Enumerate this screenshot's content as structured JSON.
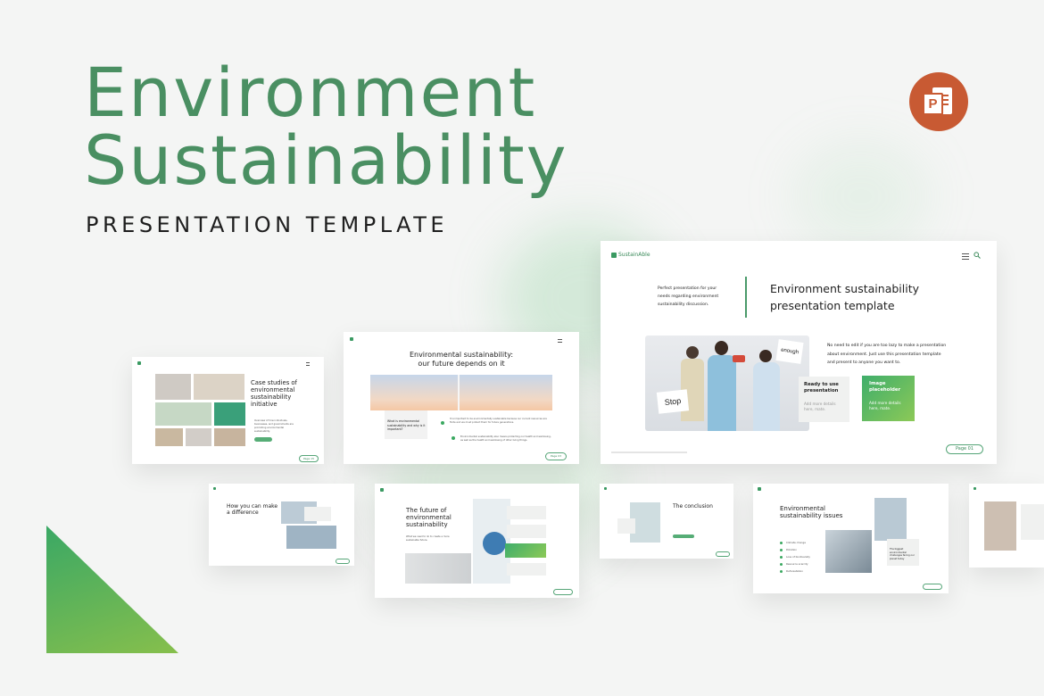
{
  "hero": {
    "title_line1": "Environment",
    "title_line2": "Sustainability",
    "subtitle": "PRESENTATION TEMPLATE",
    "app_icon": "powerpoint-icon",
    "app_badge": "P"
  },
  "colors": {
    "brand_green": "#4a8f62",
    "powerpoint_orange": "#c85a33",
    "background": "#f4f5f4"
  },
  "main_slide": {
    "brand": "SustainAble",
    "intro": "Perfect presentation for your needs regarding environment sustainability discussion.",
    "title": "Environment sustainability presentation template",
    "body": "No need to edit if you are too lazy to make a presentation about environment. Just use this presentation template and present to anyone you want to.",
    "card1_title": "Ready to use presentation",
    "card1_text": "Add more details here, mate.",
    "card2_title": "Image placeholder",
    "card2_text": "Add more details here, mate.",
    "photo_sign_1": "Stop",
    "photo_sign_2": "enough",
    "page": "Page 01"
  },
  "slide_case": {
    "title": "Case studies of environmental sustainability initiative",
    "body": "Overview of how individuals, businesses, and governments are promoting environmental sustainability.",
    "page": "Page 15"
  },
  "slide_future": {
    "title": "Environmental sustainability: our future depends on it",
    "question": "What is environmental sustainability and why is it important?",
    "bullet1": "It is important to be environmentally sustainable because our current resources are finite and we must protect them for future generations.",
    "bullet2": "Environmental sustainability also means protecting our health and well-being, as well as the health and well-being of other living things.",
    "page": "Page 03"
  },
  "slide_difference": {
    "title": "How you can make a difference"
  },
  "slide_future2": {
    "title": "The future of environmental sustainability",
    "text": "What we need to do to create a more sustainable future."
  },
  "slide_conclusion": {
    "title": "The conclusion"
  },
  "slide_issues": {
    "title": "Environmental sustainability issues",
    "bullets": [
      "Climate change",
      "Pollution",
      "Loss of biodiversity",
      "Resource scarcity",
      "Deforestation"
    ],
    "callout": "The biggest environmental challenges facing our planet today"
  }
}
